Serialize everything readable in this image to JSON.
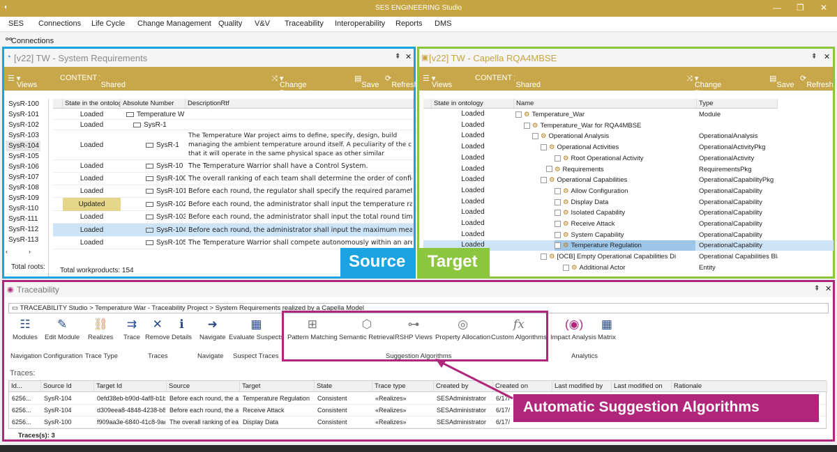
{
  "window": {
    "title": "SES ENGINEERING Studio"
  },
  "menu": [
    "SES",
    "Connections",
    "Life Cycle",
    "Change Management",
    "Quality",
    "V&V",
    "Traceability",
    "Interoperability",
    "Reports",
    "DMS"
  ],
  "connections_label": "Connections",
  "left_panel": {
    "title": "[v22] TW - System Requirements",
    "toolbar": {
      "views": "Views",
      "content": "CONTENT",
      "shared": "Shared",
      "change_request": "Change Request",
      "save": "Save",
      "refresh": "Refresh"
    },
    "side_list": [
      "SysR-100",
      "SysR-101",
      "SysR-102",
      "SysR-103",
      "SysR-104",
      "SysR-105",
      "SysR-106",
      "SysR-107",
      "SysR-108",
      "SysR-109",
      "SysR-110",
      "SysR-111",
      "SysR-112",
      "SysR-113"
    ],
    "total_roots_label": "Total roots:",
    "columns": [
      "State in the ontology",
      "Absolute Number",
      "DescriptionRtf"
    ],
    "rows": [
      {
        "state": "Loaded",
        "number": "Temperature W",
        "desc": ""
      },
      {
        "state": "Loaded",
        "number": "SysR-1",
        "desc": ""
      },
      {
        "state": "Loaded",
        "number": "SysR-1",
        "desc": "The Temperature War project aims to define, specify, design, build managing the ambient temperature around itself. A peculiarity of the c that it will operate in the same physical space as other similar systems."
      },
      {
        "state": "Loaded",
        "number": "SysR-10",
        "desc": "The Temperature Warrior shall have a Control System."
      },
      {
        "state": "Loaded",
        "number": "SysR-100",
        "desc": "The overall ranking of each team shall determine the order of configura"
      },
      {
        "state": "Loaded",
        "number": "SysR-101",
        "desc": "Before each round, the regulator shall specify the required parameters"
      },
      {
        "state": "Updated",
        "number": "SysR-102",
        "desc": "Before each round, the administrator shall input the temperature range"
      },
      {
        "state": "Loaded",
        "number": "SysR-103",
        "desc": "Before each round, the administrator shall input the total round time."
      },
      {
        "state": "Loaded",
        "number": "SysR-104",
        "desc": "Before each round, the administrator shall input the maximum measur"
      },
      {
        "state": "Loaded",
        "number": "SysR-105",
        "desc": "The Temperature Warrior shall compete autonomously within an arena"
      }
    ],
    "total_workproducts": "Total workproducts: 154"
  },
  "right_panel": {
    "title": "[v22] TW - Capella RQA4MBSE",
    "toolbar": {
      "views": "Views",
      "content": "CONTENT",
      "shared": "Shared",
      "change_request": "Change Request",
      "save": "Save",
      "refresh": "Refresh"
    },
    "columns": [
      "State in ontology",
      "Name",
      "Type"
    ],
    "rows": [
      {
        "state": "Loaded",
        "name": "Temperature_War",
        "type": "Module"
      },
      {
        "state": "Loaded",
        "name": "Temperature_War for RQA4MBSE",
        "type": ""
      },
      {
        "state": "Loaded",
        "name": "Operational Analysis",
        "type": "OperationalAnalysis"
      },
      {
        "state": "Loaded",
        "name": "Operational Activities",
        "type": "OperationalActivityPkg"
      },
      {
        "state": "Loaded",
        "name": "Root Operational Activity",
        "type": "OperationalActivity"
      },
      {
        "state": "Loaded",
        "name": "Requirements",
        "type": "RequirementsPkg"
      },
      {
        "state": "Loaded",
        "name": "Operational Capabilities",
        "type": "OperationalCapabilityPkg"
      },
      {
        "state": "Loaded",
        "name": "Allow Configuration",
        "type": "OperationalCapability"
      },
      {
        "state": "Loaded",
        "name": "Display Data",
        "type": "OperationalCapability"
      },
      {
        "state": "Loaded",
        "name": "Isolated Capability",
        "type": "OperationalCapability"
      },
      {
        "state": "Loaded",
        "name": "Receive Attack",
        "type": "OperationalCapability"
      },
      {
        "state": "Loaded",
        "name": "System Capability",
        "type": "OperationalCapability"
      },
      {
        "state": "Loaded",
        "name": "Temperature Regulation",
        "type": "OperationalCapability"
      },
      {
        "state": "Loaded",
        "name": "[OCB] Empty Operational Capabilities Di",
        "type": "Operational Capabilities Blanl"
      },
      {
        "state": "",
        "name": "Additional Actor",
        "type": "Entity"
      }
    ]
  },
  "source_label": "Source",
  "target_label": "Target",
  "traceability": {
    "title": "Traceability",
    "breadcrumb": "TRACEABILITY Studio  >  Temperature War - Traceability Project  >  System Requirements realized by a Capella Model",
    "ribbon": [
      {
        "label": "Modules",
        "icon": "modules-icon"
      },
      {
        "label": "Edit Module",
        "icon": "edit-module-icon"
      },
      {
        "label": "Realizes",
        "icon": "chain-icon"
      },
      {
        "label": "Trace",
        "icon": "trace-icon"
      },
      {
        "label": "Remove",
        "icon": "remove-icon"
      },
      {
        "label": "Details",
        "icon": "details-icon"
      },
      {
        "label": "Navigate",
        "icon": "navigate-icon"
      },
      {
        "label": "Evaluate Suspects",
        "icon": "suspects-icon"
      },
      {
        "label": "Pattern Matching",
        "icon": "pattern-icon"
      },
      {
        "label": "Semantic Retrieval",
        "icon": "semantic-icon"
      },
      {
        "label": "RSHP Views",
        "icon": "rshp-icon"
      },
      {
        "label": "Property Allocation",
        "icon": "property-icon"
      },
      {
        "label": "Custom Algorithms",
        "icon": "fx-icon"
      },
      {
        "label": "Impact Analysis",
        "icon": "impact-icon"
      },
      {
        "label": "Matrix",
        "icon": "matrix-icon"
      }
    ],
    "groups": [
      "Navigation",
      "Configuration",
      "Trace Type",
      "Traces",
      "Navigate",
      "Suspect Traces",
      "Suggestion Algorithms",
      "Analytics"
    ],
    "traces_label": "Traces:",
    "columns": [
      "Id...",
      "Source Id",
      "Target Id",
      "Source",
      "Target",
      "State",
      "Trace type",
      "Created by",
      "Created on",
      "Last modified by",
      "Last modified on",
      "Rationale"
    ],
    "rows": [
      {
        "id": "6256...",
        "source_id": "SysR-104",
        "target_id": "0efd38eb-b90d-4af8-b1b...",
        "source": "Before each round, the ad...",
        "target": "Temperature Regulation",
        "state": "Consistent",
        "type": "«Realizes»",
        "created_by": "SESAdministrator",
        "created_on": "6/17/"
      },
      {
        "id": "6256...",
        "source_id": "SysR-104",
        "target_id": "d309eea8-4848-4238-b8...",
        "source": "Before each round, the ad...",
        "target": "Receive Attack",
        "state": "Consistent",
        "type": "«Realizes»",
        "created_by": "SESAdministrator",
        "created_on": "6/17/"
      },
      {
        "id": "6256...",
        "source_id": "SysR-100",
        "target_id": "f909aa3e-6840-41c8-9ae...",
        "source": "The overall ranking of eac...",
        "target": "Display Data",
        "state": "Consistent",
        "type": "«Realizes»",
        "created_by": "SESAdministrator",
        "created_on": "6/17/"
      }
    ],
    "count": "Traces(s): 3"
  },
  "callout": "Automatic Suggestion Algorithms",
  "colors": {
    "brand": "#c6a442",
    "source": "#1aa3e0",
    "target": "#8cc63e",
    "traceability": "#b0267a"
  }
}
